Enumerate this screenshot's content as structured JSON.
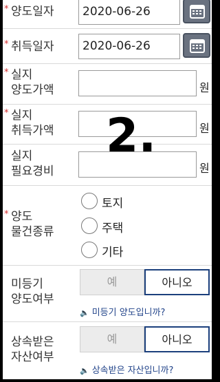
{
  "fields": {
    "transfer_date": {
      "label": "양도일자",
      "required": "*",
      "value": "2020-06-26",
      "icon": "calendar-icon"
    },
    "acquire_date": {
      "label": "취득일자",
      "required": "*",
      "value": "2020-06-26",
      "icon": "calendar-icon"
    },
    "transfer_price": {
      "label": "실지\n양도가액",
      "required": "*",
      "value": "",
      "unit": "원"
    },
    "acquire_price": {
      "label": "실지\n취득가액",
      "required": "*",
      "value": "",
      "unit": "원"
    },
    "expense": {
      "label": "실지\n필요경비",
      "value": "",
      "unit": "원"
    },
    "property_type": {
      "label": "양도\n물건종류",
      "required": "*",
      "options": [
        "토지",
        "주택",
        "기타"
      ]
    },
    "unregistered": {
      "label": "미등기\n양도여부",
      "yes": "예",
      "no": "아니오",
      "selected": "아니오",
      "hint": "미등기 양도입니까?",
      "hint_icon": "speaker-icon"
    },
    "inherited": {
      "label": "상속받은\n자산여부",
      "yes": "예",
      "no": "아니오",
      "selected": "아니오",
      "hint": "상속받은 자산입니까?",
      "hint_icon": "speaker-icon"
    }
  },
  "overlay_number": "2."
}
